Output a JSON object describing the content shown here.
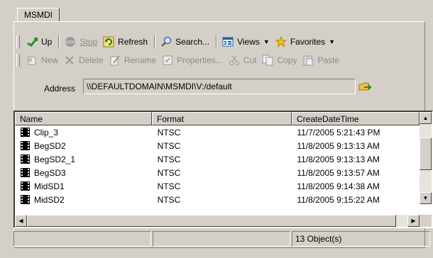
{
  "tab": {
    "label": "MSMDI"
  },
  "toolbar1": {
    "up": "Up",
    "stop": "Stop",
    "refresh": "Refresh",
    "search": "Search...",
    "views": "Views",
    "favorites": "Favorites"
  },
  "toolbar2": {
    "new": "New",
    "delete": "Delete",
    "rename": "Rename",
    "properties": "Properties...",
    "cut": "Cut",
    "copy": "Copy",
    "paste": "Paste"
  },
  "address": {
    "label": "Address",
    "value": "\\\\DEFAULTDOMAIN\\MSMDI\\V:/default"
  },
  "list": {
    "columns": [
      "Name",
      "Format",
      "CreateDateTime"
    ],
    "rows": [
      {
        "name": "Clip_3",
        "format": "NTSC",
        "created": "11/7/2005 5:21:43 PM"
      },
      {
        "name": "BegSD2",
        "format": "NTSC",
        "created": "11/8/2005 9:13:13 AM"
      },
      {
        "name": "BegSD2_1",
        "format": "NTSC",
        "created": "11/8/2005 9:13:13 AM"
      },
      {
        "name": "BegSD3",
        "format": "NTSC",
        "created": "11/8/2005 9:13:57 AM"
      },
      {
        "name": "MidSD1",
        "format": "NTSC",
        "created": "11/8/2005 9:14:38 AM"
      },
      {
        "name": "MidSD2",
        "format": "NTSC",
        "created": "11/8/2005 9:15:22 AM"
      }
    ]
  },
  "status": {
    "panel1": "",
    "panel2": "",
    "count": "13 Object(s)"
  },
  "colors": {
    "face": "#d4d0c8",
    "shadow": "#808080",
    "disabled": "#8b8b8b"
  },
  "icons": [
    "up-arrow-icon",
    "stop-icon",
    "refresh-icon",
    "search-icon",
    "views-icon",
    "favorites-star-icon",
    "new-icon",
    "delete-icon",
    "rename-icon",
    "properties-icon",
    "cut-icon",
    "copy-icon",
    "paste-icon",
    "folder-go-icon",
    "film-icon"
  ]
}
